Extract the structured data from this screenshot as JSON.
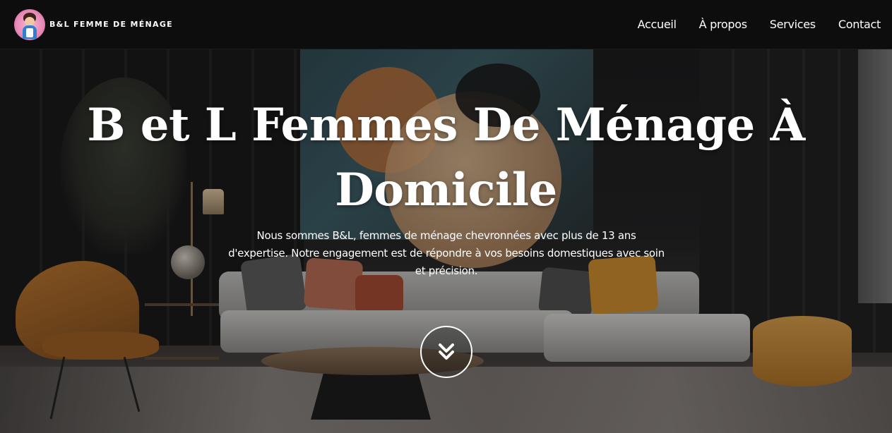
{
  "header": {
    "brand_name": "B&L FEMME DE MÉNAGE",
    "logo_icon": "housekeeper-logo-icon",
    "nav": [
      {
        "label": "Accueil"
      },
      {
        "label": "À propos"
      },
      {
        "label": "Services"
      },
      {
        "label": "Contact"
      }
    ]
  },
  "hero": {
    "title": "B et L Femmes De Ménage À Domicile",
    "description": "Nous sommes B&L, femmes de ménage chevronnées avec plus de 13 ans d'expertise. Notre engagement est de répondre à vos besoins domestiques avec soin et précision.",
    "scroll_icon": "double-chevron-down-icon"
  },
  "colors": {
    "header_bg": "#0c0c0c",
    "text": "#ffffff",
    "logo_pink": "#e889b6"
  }
}
